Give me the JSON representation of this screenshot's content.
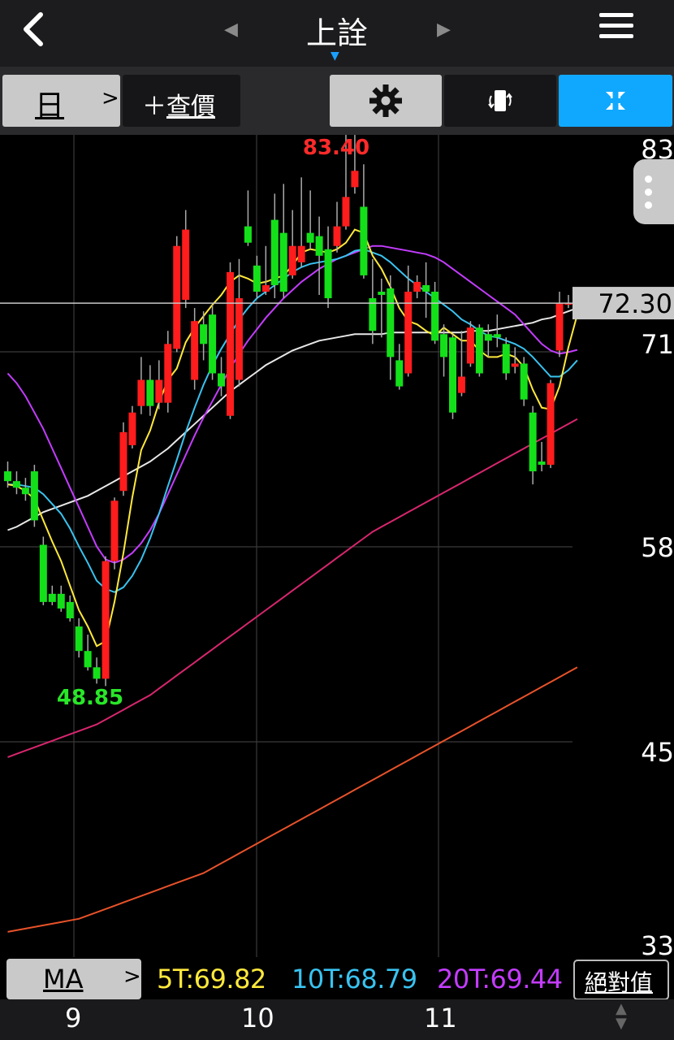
{
  "header": {
    "back_icon": "chevron-left-icon",
    "title": "上詮",
    "prev_icon": "triangle-left-icon",
    "next_icon": "triangle-right-icon",
    "menu_icon": "hamburger-menu-icon"
  },
  "toolbar": {
    "period_label": "日",
    "period_chevron": ">",
    "add_quote_plus": "＋",
    "add_quote_label": "查價",
    "settings_icon": "gear-icon",
    "rotate_icon": "rotate-screen-icon",
    "fullscreen_icon": "collapse-arrows-icon"
  },
  "colors": {
    "up": "#ff1c1c",
    "down": "#14e01a",
    "ma5": "#ffe93b",
    "ma10": "#39c3f0",
    "ma20": "#c43cff",
    "ma60": "#e8e8e8",
    "ma120": "#d8266e",
    "ma240": "#e8522a",
    "accent": "#10a8ff"
  },
  "chart_data": {
    "type": "candlestick",
    "ylim": [
      33,
      85
    ],
    "y_ticks": [
      "83",
      "71",
      "58",
      "45",
      "33"
    ],
    "x_ticks": [
      "9",
      "10",
      "11"
    ],
    "current_price": "72.30",
    "high_label": "83.40",
    "low_label": "48.85",
    "candles": [
      [
        62.0,
        61.4,
        62.6,
        61.0
      ],
      [
        61.4,
        61.0,
        62.0,
        60.6
      ],
      [
        61.0,
        60.6,
        61.6,
        60.2
      ],
      [
        62.0,
        59.0,
        62.4,
        58.6
      ],
      [
        57.5,
        54.0,
        58.0,
        53.8
      ],
      [
        54.5,
        54.0,
        55.0,
        53.8
      ],
      [
        54.5,
        53.6,
        55.0,
        53.4
      ],
      [
        54.0,
        53.0,
        54.4,
        52.8
      ],
      [
        52.5,
        51.0,
        53.0,
        50.6
      ],
      [
        51.0,
        50.0,
        52.0,
        49.8
      ],
      [
        50.0,
        49.3,
        50.6,
        49.0
      ],
      [
        49.3,
        56.5,
        56.8,
        48.85
      ],
      [
        56.5,
        60.2,
        60.4,
        56.0
      ],
      [
        60.8,
        64.4,
        65.0,
        60.5
      ],
      [
        63.6,
        65.6,
        66.0,
        63.4
      ],
      [
        66.0,
        67.6,
        69.0,
        65.5
      ],
      [
        67.6,
        66.0,
        68.5,
        65.4
      ],
      [
        66.2,
        67.6,
        68.8,
        65.8
      ],
      [
        66.2,
        69.8,
        70.6,
        65.6
      ],
      [
        69.5,
        75.8,
        76.4,
        69.3
      ],
      [
        72.5,
        76.8,
        78.0,
        72.0
      ],
      [
        67.6,
        71.2,
        72.0,
        67.0
      ],
      [
        71.0,
        69.8,
        71.8,
        68.8
      ],
      [
        71.6,
        68.0,
        72.2,
        67.6
      ],
      [
        68.0,
        67.2,
        69.0,
        66.6
      ],
      [
        65.4,
        74.2,
        74.8,
        65.2
      ],
      [
        67.6,
        72.6,
        75.0,
        67.2
      ],
      [
        77.0,
        76.0,
        79.2,
        75.8
      ],
      [
        74.6,
        73.0,
        75.2,
        72.6
      ],
      [
        73.0,
        73.4,
        75.8,
        72.8
      ],
      [
        77.4,
        73.4,
        79.0,
        72.6
      ],
      [
        76.6,
        73.0,
        79.6,
        72.6
      ],
      [
        74.0,
        75.8,
        78.0,
        73.8
      ],
      [
        74.8,
        75.8,
        80.0,
        74.5
      ],
      [
        76.6,
        76.0,
        79.2,
        75.6
      ],
      [
        76.4,
        75.2,
        77.6,
        72.8
      ],
      [
        75.6,
        72.6,
        77.0,
        72.0
      ],
      [
        75.8,
        77.0,
        78.5,
        75.4
      ],
      [
        77.0,
        78.8,
        83.4,
        76.8
      ],
      [
        79.4,
        80.4,
        82.6,
        79.0
      ],
      [
        78.2,
        74.0,
        80.8,
        73.8
      ],
      [
        72.6,
        70.6,
        75.0,
        69.8
      ],
      [
        73.0,
        72.8,
        73.8,
        70.2
      ],
      [
        73.2,
        69.0,
        74.0,
        67.6
      ],
      [
        68.8,
        67.2,
        69.8,
        67.0
      ],
      [
        68.0,
        73.0,
        74.6,
        67.8
      ],
      [
        73.0,
        73.6,
        74.0,
        72.6
      ],
      [
        73.4,
        73.0,
        74.8,
        71.4
      ],
      [
        73.0,
        70.0,
        73.6,
        69.8
      ],
      [
        70.4,
        69.0,
        71.0,
        67.8
      ],
      [
        70.2,
        65.6,
        70.4,
        65.2
      ],
      [
        66.8,
        67.8,
        70.6,
        66.6
      ],
      [
        68.6,
        70.8,
        71.2,
        68.4
      ],
      [
        70.8,
        68.0,
        71.0,
        67.8
      ],
      [
        70.4,
        70.0,
        71.0,
        69.0
      ],
      [
        70.4,
        70.2,
        71.6,
        69.6
      ],
      [
        69.8,
        68.0,
        70.2,
        67.6
      ],
      [
        68.4,
        68.6,
        69.6,
        68.0
      ],
      [
        68.6,
        66.4,
        69.0,
        66.0
      ],
      [
        65.6,
        62.0,
        66.0,
        61.2
      ],
      [
        62.6,
        62.4,
        63.8,
        62.0
      ],
      [
        62.4,
        67.4,
        67.6,
        62.2
      ],
      [
        69.4,
        72.3,
        73.0,
        69.0
      ],
      [
        72.3,
        72.3,
        72.8,
        72.0
      ],
      [
        72.3,
        72.3,
        72.6,
        72.0
      ]
    ],
    "ma5": [
      61.2,
      61.1,
      60.8,
      60.3,
      59.0,
      57.7,
      56.5,
      55.0,
      53.5,
      52.5,
      51.3,
      51.6,
      54.0,
      57.0,
      60.4,
      63.3,
      64.5,
      66.2,
      67.6,
      68.3,
      69.9,
      70.8,
      71.5,
      72.2,
      72.8,
      73.6,
      74.0,
      73.8,
      73.5,
      73.6,
      73.8,
      74.0,
      74.6,
      75.4,
      75.6,
      75.5,
      75.4,
      75.6,
      76.0,
      76.8,
      76.6,
      75.2,
      74.4,
      73.3,
      72.0,
      71.2,
      71.0,
      70.6,
      70.3,
      70.8,
      70.4,
      70.0,
      70.0,
      69.4,
      69.0,
      69.0,
      69.2,
      69.0,
      68.4,
      67.0,
      65.9,
      65.8,
      67.2,
      69.6,
      71.6
    ],
    "ma10": [
      61.2,
      61.2,
      61.1,
      61.0,
      60.6,
      60.0,
      59.4,
      58.5,
      57.4,
      56.4,
      55.3,
      54.8,
      54.6,
      54.9,
      55.6,
      56.6,
      57.9,
      59.4,
      61.1,
      62.7,
      64.4,
      65.9,
      67.3,
      68.5,
      69.5,
      70.4,
      71.3,
      72.0,
      72.6,
      73.0,
      73.4,
      73.8,
      74.2,
      74.5,
      74.7,
      74.8,
      74.9,
      75.0,
      75.2,
      75.5,
      75.6,
      75.4,
      75.2,
      74.8,
      74.3,
      73.8,
      73.4,
      73.0,
      72.6,
      72.2,
      71.8,
      71.3,
      71.0,
      70.6,
      70.3,
      70.2,
      70.0,
      69.8,
      69.5,
      69.0,
      68.4,
      67.8,
      67.8,
      68.2,
      68.8
    ],
    "ma20": [
      68.0,
      67.4,
      66.6,
      65.6,
      64.6,
      63.4,
      62.2,
      61.0,
      59.8,
      58.6,
      57.4,
      56.6,
      56.4,
      56.6,
      57.0,
      57.6,
      58.4,
      59.4,
      60.6,
      61.8,
      63.0,
      64.2,
      65.3,
      66.3,
      67.3,
      68.3,
      69.2,
      70.0,
      70.7,
      71.4,
      72.0,
      72.6,
      73.1,
      73.6,
      74.0,
      74.4,
      74.7,
      75.0,
      75.2,
      75.4,
      75.6,
      75.8,
      75.8,
      75.7,
      75.6,
      75.5,
      75.4,
      75.3,
      75.1,
      74.8,
      74.4,
      74.0,
      73.6,
      73.2,
      72.8,
      72.4,
      72.0,
      71.6,
      71.0,
      70.4,
      69.8,
      69.4,
      69.2,
      69.3,
      69.44
    ],
    "ma60": [
      58.4,
      58.6,
      58.9,
      59.2,
      59.5,
      59.7,
      59.9,
      60.1,
      60.3,
      60.5,
      60.8,
      61.1,
      61.4,
      61.7,
      62.0,
      62.3,
      62.6,
      63.0,
      63.4,
      63.9,
      64.4,
      64.9,
      65.4,
      65.9,
      66.4,
      66.9,
      67.3,
      67.7,
      68.1,
      68.5,
      68.8,
      69.1,
      69.4,
      69.6,
      69.8,
      70.0,
      70.1,
      70.2,
      70.3,
      70.4,
      70.4,
      70.4,
      70.4,
      70.5,
      70.5,
      70.5,
      70.5,
      70.5,
      70.5,
      70.5,
      70.5,
      70.5,
      70.6,
      70.6,
      70.6,
      70.7,
      70.8,
      70.9,
      71.0,
      71.1,
      71.3,
      71.4,
      71.6,
      71.8,
      72.0
    ],
    "ma120": [
      44.5,
      44.7,
      44.9,
      45.1,
      45.3,
      45.5,
      45.7,
      45.9,
      46.1,
      46.3,
      46.5,
      46.8,
      47.1,
      47.4,
      47.7,
      48.0,
      48.3,
      48.7,
      49.1,
      49.5,
      49.9,
      50.3,
      50.7,
      51.1,
      51.5,
      51.9,
      52.3,
      52.7,
      53.1,
      53.5,
      53.9,
      54.3,
      54.7,
      55.1,
      55.5,
      55.9,
      56.3,
      56.7,
      57.1,
      57.5,
      57.9,
      58.3,
      58.6,
      58.9,
      59.2,
      59.5,
      59.8,
      60.1,
      60.4,
      60.7,
      61.0,
      61.3,
      61.6,
      61.9,
      62.2,
      62.5,
      62.8,
      63.1,
      63.4,
      63.7,
      64.0,
      64.3,
      64.6,
      64.9,
      65.2
    ],
    "ma240": [
      33.8,
      33.9,
      34.0,
      34.1,
      34.2,
      34.3,
      34.4,
      34.5,
      34.6,
      34.8,
      35.0,
      35.2,
      35.4,
      35.6,
      35.8,
      36.0,
      36.2,
      36.4,
      36.6,
      36.8,
      37.0,
      37.2,
      37.4,
      37.7,
      38.0,
      38.3,
      38.6,
      38.9,
      39.2,
      39.5,
      39.8,
      40.1,
      40.4,
      40.7,
      41.0,
      41.3,
      41.6,
      41.9,
      42.2,
      42.5,
      42.8,
      43.1,
      43.4,
      43.7,
      44.0,
      44.3,
      44.6,
      44.9,
      45.2,
      45.5,
      45.8,
      46.1,
      46.4,
      46.7,
      47.0,
      47.3,
      47.6,
      47.9,
      48.2,
      48.5,
      48.8,
      49.1,
      49.4,
      49.7,
      50.0
    ]
  },
  "ma_bar": {
    "label": "MA",
    "chevron": ">",
    "ma5": "5T:69.82",
    "ma10": "10T:68.79",
    "ma20": "20T:69.44",
    "abs_label": "絕對值"
  },
  "dates": {
    "d9": "9",
    "d10": "10",
    "d11": "11"
  }
}
